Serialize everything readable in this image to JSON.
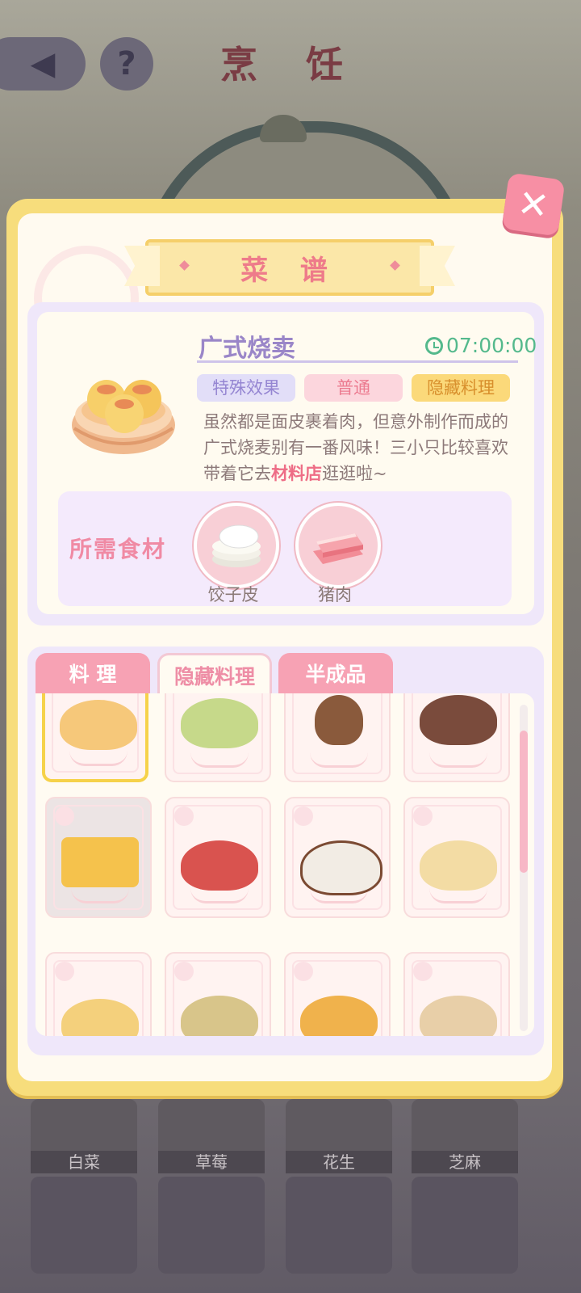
{
  "screen": {
    "title": "烹 饪",
    "back_icon": "back-arrow-icon",
    "help_label": "?"
  },
  "background_ingredients": [
    "白菜",
    "草莓",
    "花生",
    "芝麻"
  ],
  "recipe_panel": {
    "title": "菜 谱",
    "close_label": "✕",
    "dish": {
      "name": "广式烧卖",
      "time": "07:00:00",
      "tags": [
        "特殊效果",
        "普通",
        "隐藏料理"
      ],
      "description_before": "虽然都是面皮裹着肉，但意外制作而成的广式烧麦别有一番风味！三小只比较喜欢带着它去",
      "description_highlight": "材料店",
      "description_after": "逛逛啦~"
    },
    "ingredients": {
      "title": "所需食材",
      "items": [
        {
          "name": "饺子皮",
          "icon": "dumpling-wrapper-icon"
        },
        {
          "name": "猪肉",
          "icon": "pork-icon"
        }
      ]
    },
    "tabs": [
      "料 理",
      "隐藏料理",
      "半成品"
    ],
    "active_tab": "隐藏料理",
    "dishes": [
      {
        "icon": "shumai-icon",
        "state": "selected"
      },
      {
        "icon": "steamed-bun-icon",
        "state": "normal"
      },
      {
        "icon": "sundae-icon",
        "state": "normal"
      },
      {
        "icon": "fruit-cake-icon",
        "state": "normal"
      },
      {
        "icon": "sandwich-icon",
        "state": "dim"
      },
      {
        "icon": "sausage-platter-icon",
        "state": "normal"
      },
      {
        "icon": "chocolate-pudding-icon",
        "state": "normal"
      },
      {
        "icon": "taco-platter-icon",
        "state": "normal"
      },
      {
        "icon": "egg-toast-icon",
        "state": "normal"
      },
      {
        "icon": "mochi-cake-icon",
        "state": "normal"
      },
      {
        "icon": "pizza-icon",
        "state": "normal"
      },
      {
        "icon": "salad-platter-icon",
        "state": "normal"
      }
    ]
  }
}
